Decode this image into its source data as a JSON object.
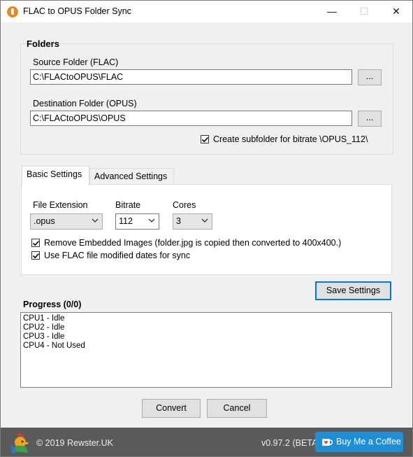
{
  "window": {
    "title": "FLAC to OPUS Folder Sync",
    "minimize_glyph": "—",
    "maximize_glyph": "☐",
    "close_glyph": "✕"
  },
  "folders": {
    "group_title": "Folders",
    "source_label": "Source Folder (FLAC)",
    "source_value": "C:\\FLACtoOPUS\\FLAC",
    "destination_label": "Destination Folder (OPUS)",
    "destination_value": "C:\\FLACtoOPUS\\OPUS",
    "browse_label": "...",
    "subfolder_checkbox_label": "Create subfolder for bitrate \\OPUS_112\\",
    "subfolder_checked": true
  },
  "tabs": [
    {
      "label": "Basic Settings",
      "active": true
    },
    {
      "label": "Advanced Settings",
      "active": false
    }
  ],
  "basic_settings": {
    "file_extension_label": "File Extension",
    "file_extension_value": ".opus",
    "bitrate_label": "Bitrate",
    "bitrate_value": "112",
    "cores_label": "Cores",
    "cores_value": "3",
    "remove_images_label": "Remove Embedded Images (folder.jpg is copied then converted to 400x400.)",
    "remove_images_checked": true,
    "modified_dates_label": "Use FLAC file modified dates for sync",
    "modified_dates_checked": true
  },
  "save_settings_label": "Save Settings",
  "progress": {
    "title": "Progress (0/0)",
    "lines": [
      "CPU1 - Idle",
      "CPU2 - Idle",
      "CPU3 - Idle",
      "CPU4 - Not Used"
    ]
  },
  "actions": {
    "convert_label": "Convert",
    "cancel_label": "Cancel"
  },
  "footer": {
    "copyright": "© 2019 Rewster.UK",
    "version": "v0.97.2 (BETA)",
    "coffee_label": "Buy Me a Coffee",
    "accent_color": "#1e8fd6",
    "background_color": "#5a5a5a"
  },
  "icons": {
    "app": "app-logo-icon",
    "checkbox_check": "check-icon",
    "dropdown": "chevron-down-icon",
    "footer_logo": "rooster-logo-icon",
    "coffee": "coffee-cup-icon"
  }
}
